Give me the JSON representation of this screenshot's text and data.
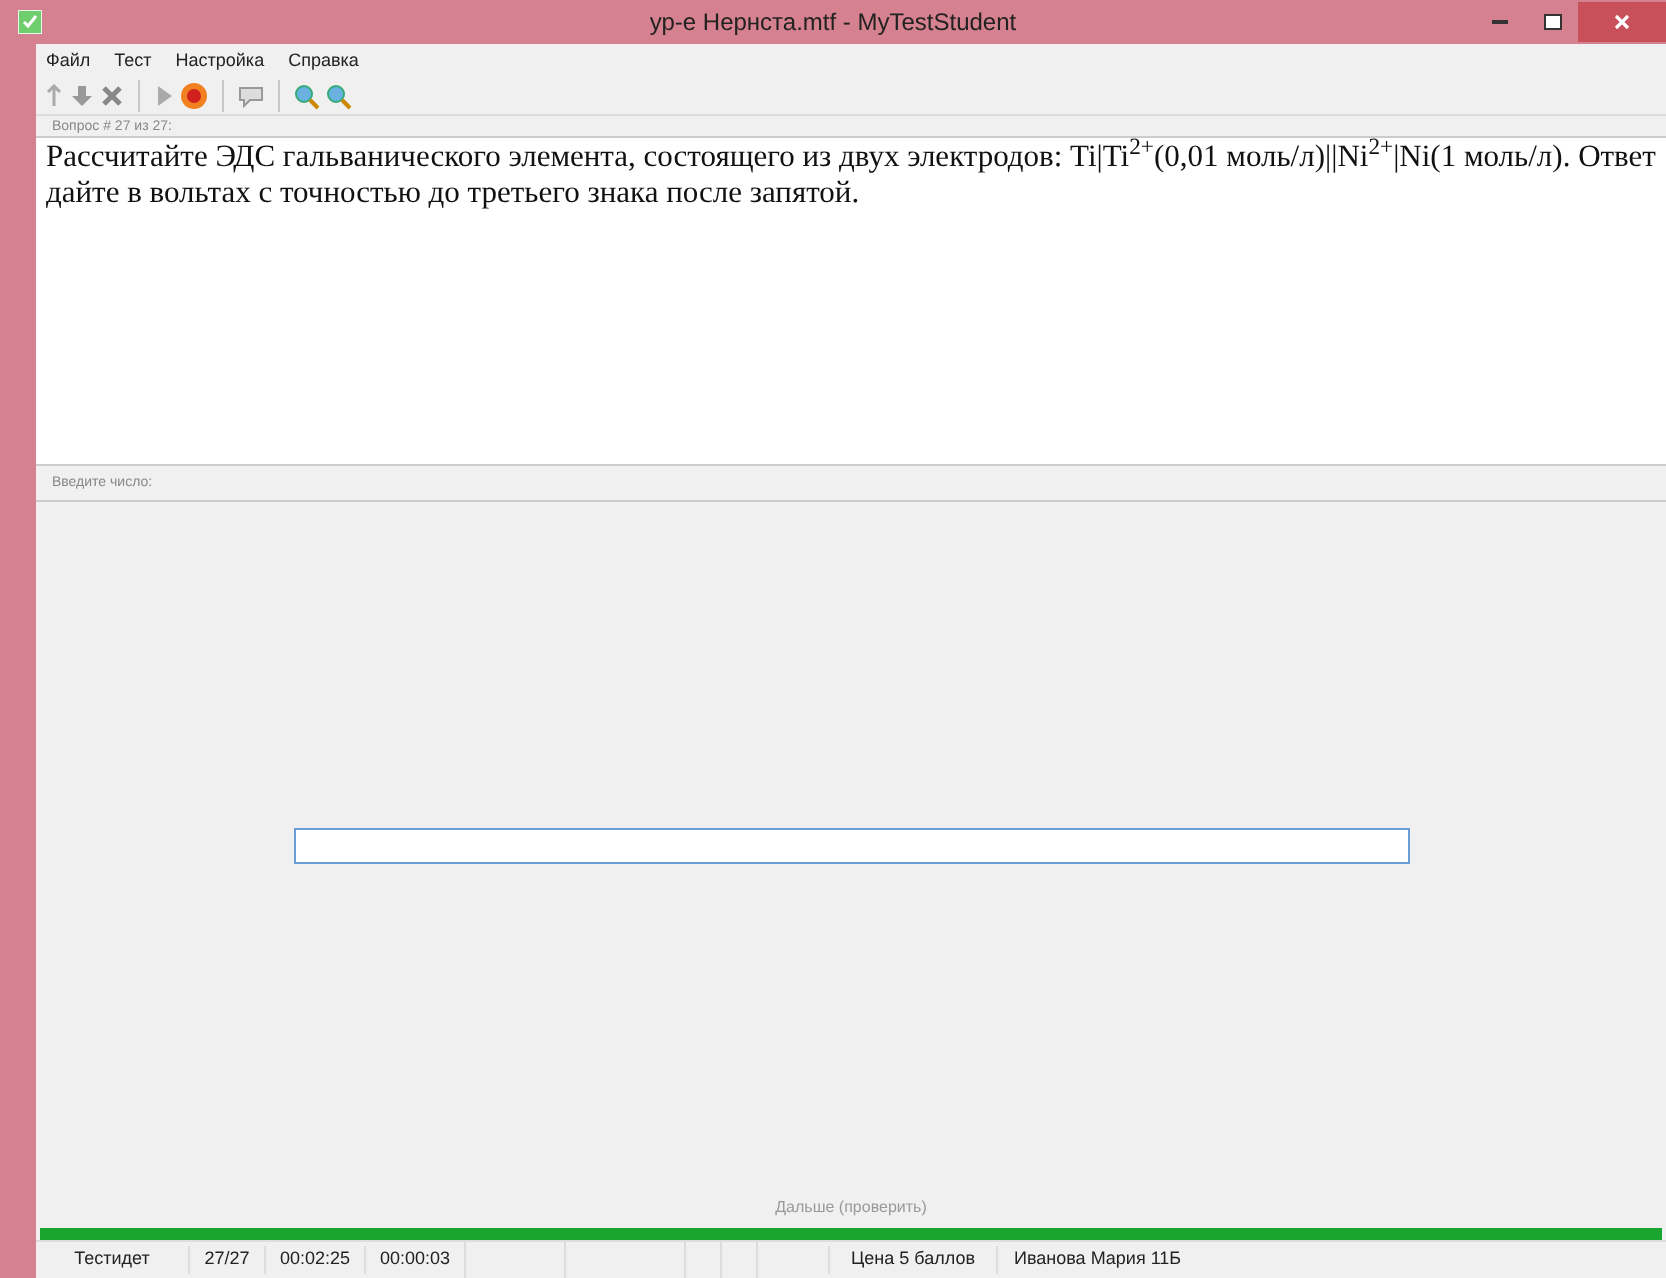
{
  "window": {
    "title": "ур-е Нернста.mtf - MyTestStudent"
  },
  "menu": [
    "Файл",
    "Тест",
    "Настройка",
    "Справка"
  ],
  "question": {
    "header": "Вопрос # 27 из 27:",
    "text": "Рассчитайте ЭДС гальванического элемента, состоящего из двух электродов: Ti|Ti$^{2+}$(0,01 моль/л)||Ni$^{2+}$|Ni(1 моль/л). Ответ дайте в вольтах с точностью до третьего знака после запятой."
  },
  "answer": {
    "header": "Введите число:"
  },
  "next_button": "Дальше (проверить)",
  "progress": {
    "level": 1
  },
  "status_bar": [
    "Тестидет",
    "27/27",
    "00:02:25",
    "00:00:03",
    "Цена 5 баллов",
    "Иванова Мария 11Б"
  ]
}
